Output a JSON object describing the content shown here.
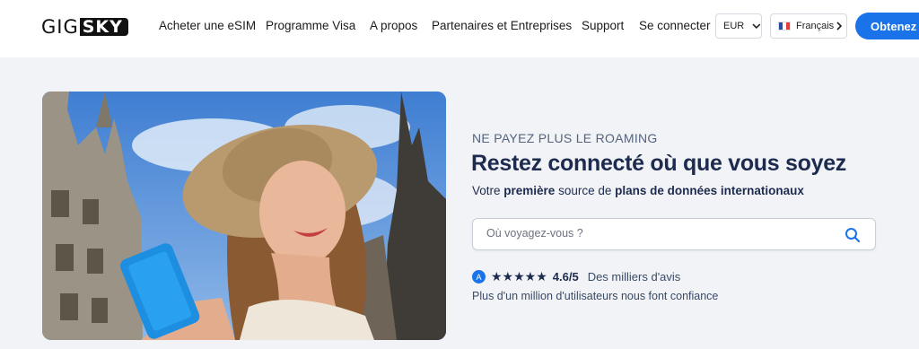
{
  "header": {
    "logo": {
      "part1": "GIG",
      "part2": "SKY"
    },
    "nav": [
      {
        "label": "Acheter une eSIM"
      },
      {
        "label": "Programme Visa"
      },
      {
        "label": "A propos"
      },
      {
        "label": "Partenaires et Entreprises"
      },
      {
        "label": "Support"
      },
      {
        "label": "Se connecter"
      }
    ],
    "currency": "EUR",
    "language": "Français",
    "cta": "Obtenez"
  },
  "hero": {
    "kicker": "NE PAYEZ PLUS LE ROAMING",
    "headline": "Restez connecté où que vous soyez",
    "subline": {
      "p1": "Votre ",
      "b1": "première",
      "p2": " source de ",
      "b2": "plans de données internationaux"
    },
    "search": {
      "placeholder": "Où voyagez-vous ?",
      "value": ""
    },
    "rating": {
      "stars": "★★★★★",
      "score": "4.6/5",
      "reviews": "Des milliers d'avis"
    },
    "trust": "Plus d'un million d'utilisateurs nous font confiance"
  },
  "colors": {
    "accent": "#1a73e8",
    "text_dark": "#1d2b4f",
    "page_bg": "#f1f3f6"
  },
  "icons": {
    "search": "search-icon",
    "chevron": "chevron-down-icon",
    "flag": "france-flag-icon",
    "app_store": "app-store-icon"
  }
}
